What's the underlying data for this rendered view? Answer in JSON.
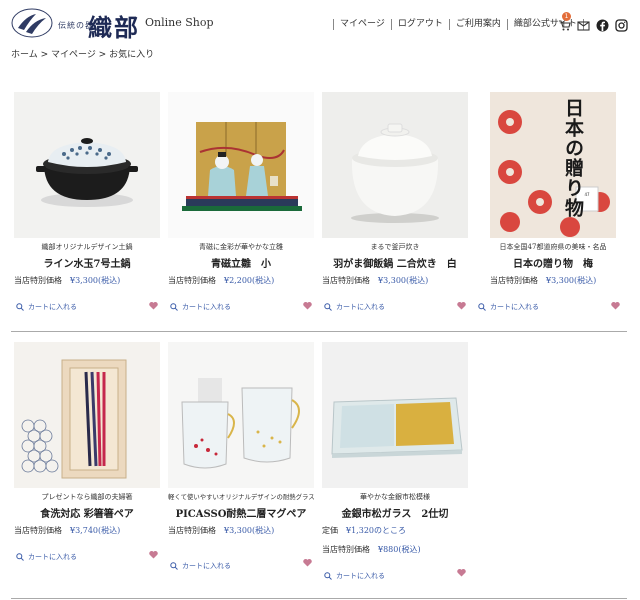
{
  "header": {
    "logo_small": "伝統の器",
    "logo_main": "織部",
    "shop_label": "Online Shop",
    "nav": [
      "マイページ",
      "ログアウト",
      "ご利用案内",
      "織部公式サイト"
    ],
    "cart_count": "1",
    "icons": [
      "cart-icon",
      "mail-icon",
      "facebook-icon",
      "instagram-icon"
    ]
  },
  "breadcrumb": "ホーム > マイページ > お気に入り",
  "cart_label": "カートに入れる",
  "price_label": "当店特別価格",
  "list_price_label": "定価",
  "colors": {
    "accent": "#3a5ba8",
    "heart": "#c77a93",
    "badge": "#e36d3a"
  },
  "products": [
    {
      "sub": "織部オリジナルデザイン土鍋",
      "name": "ライン水玉7号土鍋",
      "price": "¥3,300(税込)"
    },
    {
      "sub": "青磁に金彩が華やかな立雛",
      "name": "青磁立雛　小",
      "price": "¥2,200(税込)"
    },
    {
      "sub": "まるで釜戸炊き",
      "name": "羽がま御飯鍋 二合炊き　白",
      "price": "¥3,300(税込)"
    },
    {
      "sub": "日本全国47都道府県の美味・名品",
      "name": "日本の贈り物　梅",
      "price": "¥3,300(税込)",
      "img_text": "日本の贈り物"
    },
    {
      "sub": "プレゼントなら織部の夫婦箸",
      "name": "食洗対応 彩箸箸ペア",
      "price": "¥3,740(税込)"
    },
    {
      "sub": "軽くて使いやすいオリジナルデザインの耐熱グラス",
      "name": "PICASSO耐熱二層マグペア",
      "price": "¥3,300(税込)"
    },
    {
      "sub": "華やかな金銀市松模様",
      "name": "金銀市松ガラス　2仕切",
      "list_price": "¥1,320のところ",
      "price": "¥880(税込)"
    }
  ]
}
